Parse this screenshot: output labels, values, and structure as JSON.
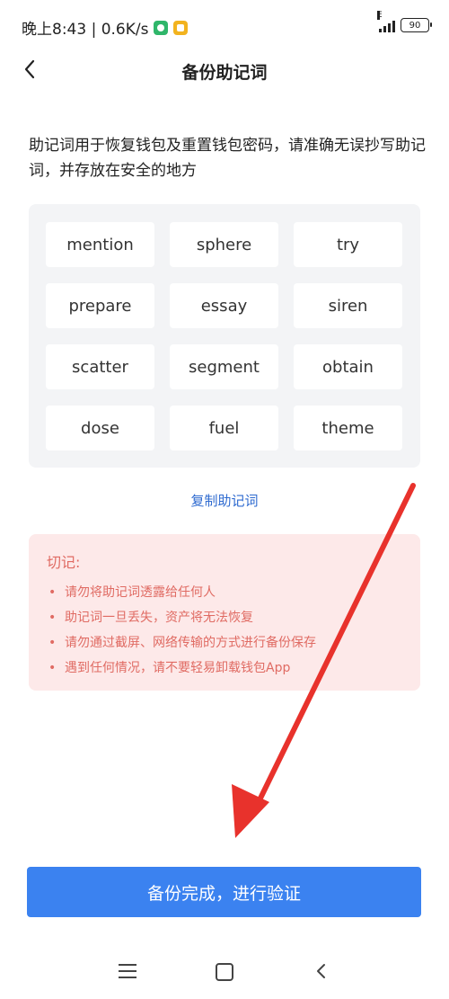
{
  "status_bar": {
    "time_speed": "晚上8:43 | 0.6K/s",
    "network": "E",
    "battery": "90"
  },
  "header": {
    "title": "备份助记词"
  },
  "description": "助记词用于恢复钱包及重置钱包密码，请准确无误抄写助记词，并存放在安全的地方",
  "mnemonic_words": [
    "mention",
    "sphere",
    "try",
    "prepare",
    "essay",
    "siren",
    "scatter",
    "segment",
    "obtain",
    "dose",
    "fuel",
    "theme"
  ],
  "copy_label": "复制助记词",
  "warning": {
    "title": "切记:",
    "items": [
      "请勿将助记词透露给任何人",
      "助记词一旦丢失，资产将无法恢复",
      "请勿通过截屏、网络传输的方式进行备份保存",
      "遇到任何情况，请不要轻易卸载钱包App"
    ]
  },
  "confirm_button": "备份完成，进行验证",
  "colors": {
    "accent": "#3b82f0",
    "link": "#2f6bd0",
    "warning_text": "#e06b63",
    "warning_bg": "#fde9e9",
    "annotation_arrow": "#e8322c"
  }
}
